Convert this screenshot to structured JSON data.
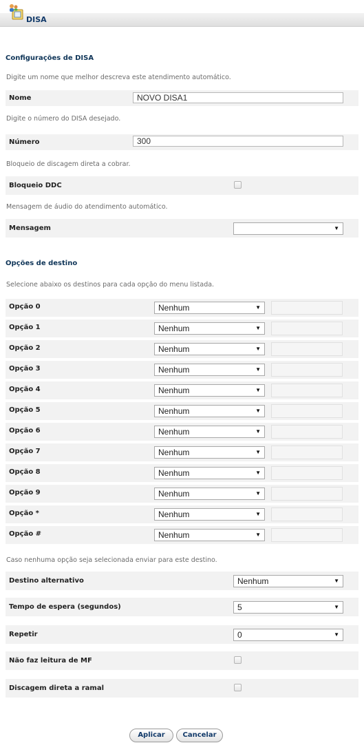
{
  "header": {
    "title": "DISA",
    "icon": "disa-users-icon"
  },
  "config": {
    "section_title": "Configurações de DISA",
    "name_hint": "Digite um nome que melhor descreva este atendimento automático.",
    "name_label": "Nome",
    "name_value": "NOVO DISA1",
    "number_hint": "Digite o número do DISA desejado.",
    "number_label": "Número",
    "number_value": "300",
    "ddc_hint": "Bloqueio de discagem direta a cobrar.",
    "ddc_label": "Bloqueio DDC",
    "message_hint": "Mensagem de áudio do atendimento automático.",
    "message_label": "Mensagem",
    "message_value": ""
  },
  "destinations": {
    "section_title": "Opções de destino",
    "hint": "Selecione abaixo os destinos para cada opção do menu listada.",
    "options": [
      {
        "label": "Opção 0",
        "value": "Nenhum"
      },
      {
        "label": "Opção 1",
        "value": "Nenhum"
      },
      {
        "label": "Opção 2",
        "value": "Nenhum"
      },
      {
        "label": "Opção 3",
        "value": "Nenhum"
      },
      {
        "label": "Opção 4",
        "value": "Nenhum"
      },
      {
        "label": "Opção 5",
        "value": "Nenhum"
      },
      {
        "label": "Opção 6",
        "value": "Nenhum"
      },
      {
        "label": "Opção 7",
        "value": "Nenhum"
      },
      {
        "label": "Opção 8",
        "value": "Nenhum"
      },
      {
        "label": "Opção 9",
        "value": "Nenhum"
      },
      {
        "label": "Opção *",
        "value": "Nenhum"
      },
      {
        "label": "Opção #",
        "value": "Nenhum"
      }
    ],
    "fallback_hint": "Caso nenhuma opção seja selecionada enviar para este destino.",
    "alt_label": "Destino alternativo",
    "alt_value": "Nenhum",
    "wait_label": "Tempo de espera (segundos)",
    "wait_value": "5",
    "repeat_label": "Repetir",
    "repeat_value": "0",
    "mf_label": "Não faz leitura de MF",
    "direct_label": "Discagem direta a ramal"
  },
  "actions": {
    "apply": "Aplicar",
    "cancel": "Cancelar"
  },
  "colors": {
    "heading": "#0f3558",
    "row_bg": "#f2f2f2",
    "button_text": "#123a6a"
  }
}
